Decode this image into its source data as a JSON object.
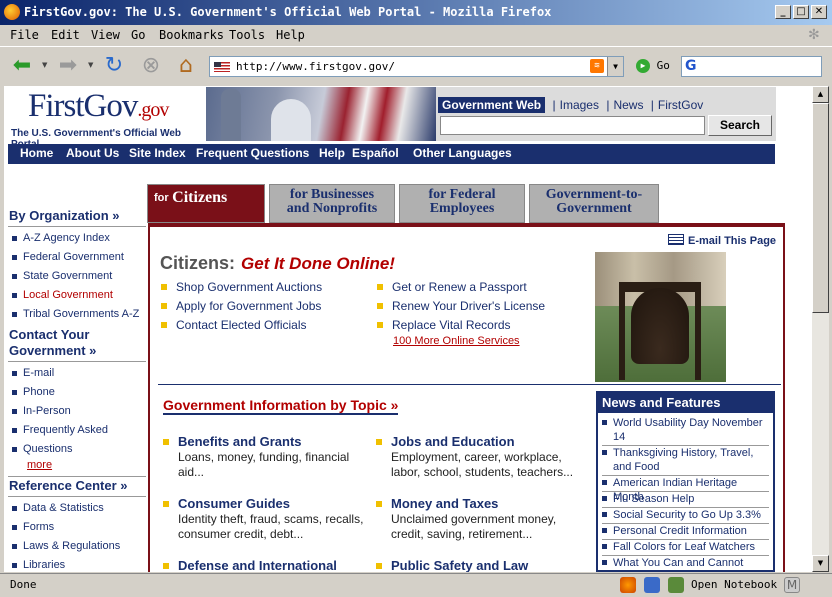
{
  "window": {
    "title": "FirstGov.gov: The U.S. Government's Official Web Portal - Mozilla Firefox"
  },
  "menu": [
    "File",
    "Edit",
    "View",
    "Go",
    "Bookmarks",
    "Tools",
    "Help"
  ],
  "toolbar": {
    "url": "http://www.firstgov.gov/",
    "go_label": "Go"
  },
  "status": {
    "text": "Done",
    "notebook": "Open Notebook"
  },
  "header": {
    "logo_main": "FirstGov",
    "logo_suffix": ".gov",
    "tagline": "The U.S. Government's Official Web Portal",
    "search_tabs": [
      "Government Web",
      "Images",
      "News",
      "FirstGov"
    ],
    "search_button": "Search"
  },
  "topnav": [
    "Home",
    "About Us",
    "Site Index",
    "Frequent Questions",
    "Help",
    "Español",
    "Other Languages"
  ],
  "sidebar": {
    "by_org": "By Organization »",
    "org_items": [
      "A-Z Agency Index",
      "Federal Government",
      "State Government",
      "Local Government",
      "Tribal Governments A-Z"
    ],
    "contact_1": "Contact Your",
    "contact_2": "Government »",
    "contact_items": [
      "E-mail",
      "Phone",
      "In-Person",
      "Frequently Asked",
      "Questions"
    ],
    "more": "more",
    "ref": "Reference Center »",
    "ref_items": [
      "Data & Statistics",
      "Forms",
      "Laws & Regulations",
      "Libraries"
    ]
  },
  "tabs": {
    "citizens_for": "for",
    "citizens": "Citizens",
    "biz_1": "for Businesses",
    "biz_2": "and Nonprofits",
    "fed_1": "for Federal",
    "fed_2": "Employees",
    "g2g_1": "Government-to-",
    "g2g_2": "Government"
  },
  "main": {
    "email_page": "E-mail This Page",
    "citizens_label": "Citizens:",
    "get_it_done": "Get It Done Online!",
    "services_left": [
      "Shop Government Auctions",
      "Apply for Government Jobs",
      "Contact Elected Officials"
    ],
    "services_right": [
      "Get or Renew a Passport",
      "Renew Your Driver's License",
      "Replace Vital Records"
    ],
    "more_services": "100 More Online Services",
    "topic_heading": "Government Information by Topic »",
    "topics": [
      {
        "title": "Benefits and Grants",
        "desc1": "Loans, money, funding, financial",
        "desc2": "aid..."
      },
      {
        "title": "Jobs and Education",
        "desc1": "Employment, career, workplace,",
        "desc2": "labor, school, students, teachers..."
      },
      {
        "title": "Consumer Guides",
        "desc1": "Identity theft, fraud, scams, recalls,",
        "desc2": "consumer credit, debt..."
      },
      {
        "title": "Money and Taxes",
        "desc1": "Unclaimed government money,",
        "desc2": "credit, saving, retirement..."
      },
      {
        "title": "Defense and International",
        "desc1": "",
        "desc2": ""
      },
      {
        "title": "Public Safety and Law",
        "desc1": "",
        "desc2": ""
      }
    ]
  },
  "news": {
    "heading": "News and Features",
    "items": [
      "World Usability Day November 14",
      "Thanksgiving History, Travel, and Food",
      "American Indian Heritage Month",
      "Flu Season Help",
      "Social Security to Go Up 3.3%",
      "Personal Credit Information",
      "Fall Colors for Leaf Watchers",
      "What You Can and Cannot Take"
    ]
  }
}
